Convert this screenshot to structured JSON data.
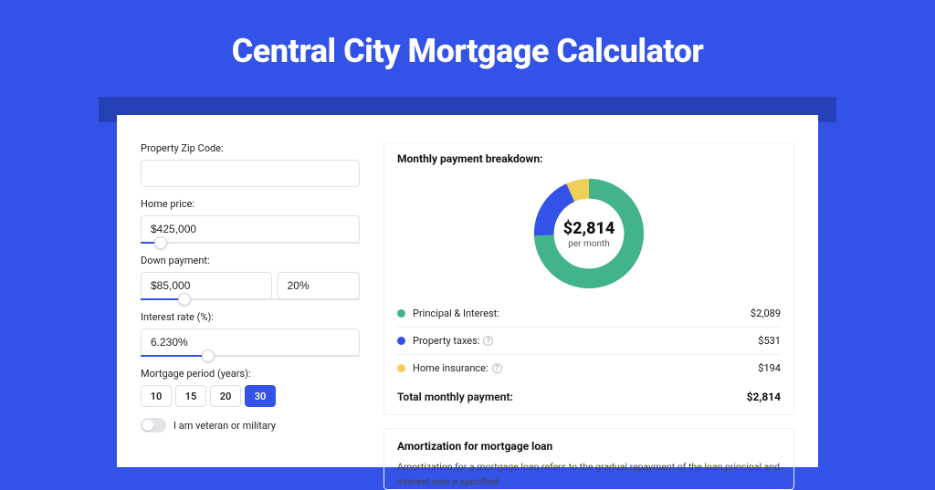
{
  "title": "Central City Mortgage Calculator",
  "form": {
    "zip_label": "Property Zip Code:",
    "zip_value": "",
    "home_price_label": "Home price:",
    "home_price_value": "$425,000",
    "home_price_slider_pct": 9,
    "down_payment_label": "Down payment:",
    "down_payment_value": "$85,000",
    "down_payment_pct_value": "20%",
    "down_payment_slider_pct": 20,
    "interest_label": "Interest rate (%):",
    "interest_value": "6.230%",
    "interest_slider_pct": 31,
    "period_label": "Mortgage period (years):",
    "periods": [
      "10",
      "15",
      "20",
      "30"
    ],
    "period_active_index": 3,
    "veteran_label": "I am veteran or military",
    "veteran_on": false
  },
  "breakdown": {
    "title": "Monthly payment breakdown:",
    "total": "$2,814",
    "per_month": "per month",
    "items": [
      {
        "label": "Principal & Interest:",
        "value": "$2,089",
        "color": "green"
      },
      {
        "label": "Property taxes:",
        "value": "$531",
        "color": "blue",
        "info": true
      },
      {
        "label": "Home insurance:",
        "value": "$194",
        "color": "yellow",
        "info": true
      }
    ],
    "total_label": "Total monthly payment:",
    "total_value": "$2,814"
  },
  "chart_data": {
    "type": "pie",
    "title": "Monthly payment breakdown",
    "series": [
      {
        "name": "Principal & Interest",
        "value": 2089,
        "color": "#43b38a"
      },
      {
        "name": "Property taxes",
        "value": 531,
        "color": "#3353e8"
      },
      {
        "name": "Home insurance",
        "value": 194,
        "color": "#efcf5a"
      }
    ],
    "center_label": "$2,814",
    "center_sub": "per month"
  },
  "amort": {
    "title": "Amortization for mortgage loan",
    "text": "Amortization for a mortgage loan refers to the gradual repayment of the loan principal and interest over a specified"
  }
}
